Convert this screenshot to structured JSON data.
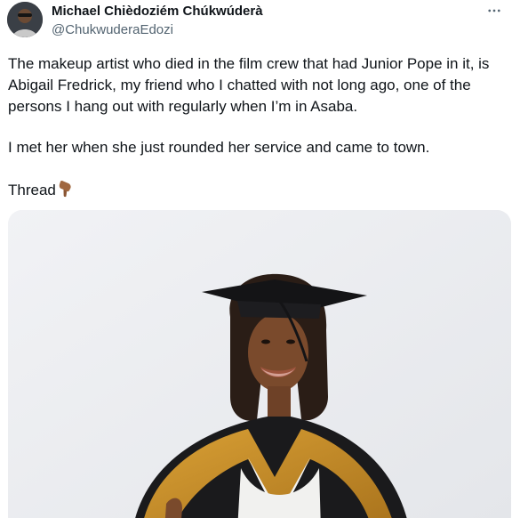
{
  "author": {
    "name": "Michael Chièdoziém Chúkwúderà",
    "handle": "@ChukwuderaEdozi",
    "avatar_icon": "user-avatar"
  },
  "more_icon": "more-horizontal-icon",
  "tweet": {
    "paragraph1": "The makeup artist who died in the film crew that had Junior Pope in it, is Abigail Fredrick, my friend who I chatted with not long ago, one of the persons I hang out with regularly when I’m in Asaba.",
    "paragraph2": "I met her when she just rounded her service and came to town.",
    "paragraph3": "Thread",
    "emoji": "pointing-down-hand-emoji"
  },
  "media": {
    "kind": "photo",
    "subject": "graduate-portrait",
    "colors": {
      "background": "#eef0f3",
      "cap": "#141416",
      "gown_trim": "#c98f26",
      "skin": "#7a4a2c"
    }
  }
}
